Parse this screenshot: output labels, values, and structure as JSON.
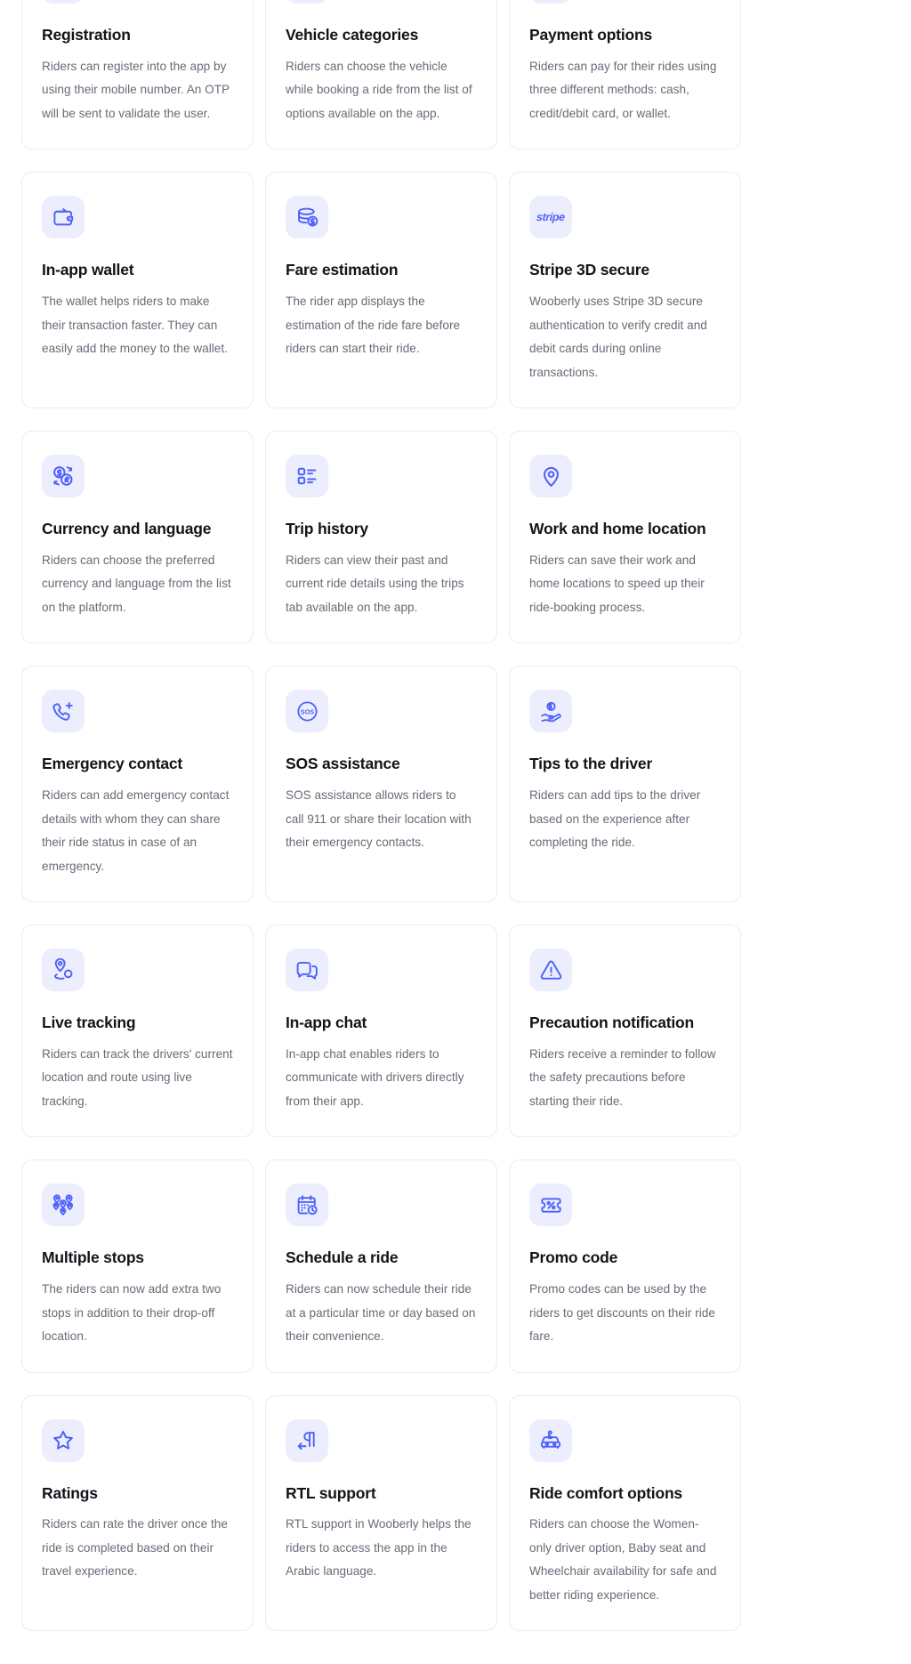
{
  "page": {
    "accent_color": "#4d61fc",
    "icon_bg_color": "#eceefd",
    "title_color": "#13131a",
    "text_color": "#6a6a78",
    "card_border_color": "#ececf1"
  },
  "features": [
    {
      "icon": "user-add-icon",
      "title": "Registration",
      "desc": "Riders can register into the app by using their mobile number. An OTP will be sent to validate the user."
    },
    {
      "icon": "car-front-icon",
      "title": "Vehicle categories",
      "desc": "Riders can choose the vehicle while booking a ride from the list of options available on the app."
    },
    {
      "icon": "credit-cards-icon",
      "title": "Payment options",
      "desc": "Riders can pay for their rides using three different methods: cash, credit/debit card, or wallet."
    },
    {
      "icon": "wallet-icon",
      "title": "In-app wallet",
      "desc": "The wallet helps riders to make their transaction faster. They can easily add the money to the wallet."
    },
    {
      "icon": "money-stack-icon",
      "title": "Fare estimation",
      "desc": "The rider app displays the estimation of the ride fare before riders can start their ride."
    },
    {
      "icon": "stripe-logo-icon",
      "title": "Stripe 3D secure",
      "desc": "Wooberly uses Stripe 3D secure authentication to verify credit and debit cards during online transactions."
    },
    {
      "icon": "currency-exchange-icon",
      "title": "Currency and language",
      "desc": "Riders can choose the preferred currency and language from the list on the platform."
    },
    {
      "icon": "list-details-icon",
      "title": "Trip history",
      "desc": "Riders can view their past and current ride details using the trips tab available on the app."
    },
    {
      "icon": "location-pin-icon",
      "title": "Work and home location",
      "desc": "Riders can save their work and home locations to speed up their ride-booking process."
    },
    {
      "icon": "phone-plus-icon",
      "title": "Emergency contact",
      "desc": "Riders can add emergency contact details with whom they can share their ride status in case of an emergency."
    },
    {
      "icon": "sos-icon",
      "title": "SOS assistance",
      "desc": "SOS assistance allows riders to call 911 or share their location with their emergency contacts."
    },
    {
      "icon": "tip-hand-coin-icon",
      "title": "Tips to the driver",
      "desc": "Riders can add tips to the driver based on the experience after completing the ride."
    },
    {
      "icon": "live-tracking-pin-icon",
      "title": "Live tracking",
      "desc": "Riders can track the drivers' current location and route using live tracking."
    },
    {
      "icon": "chat-bubbles-icon",
      "title": "In-app chat",
      "desc": "In-app chat enables riders to communicate with drivers directly from their app."
    },
    {
      "icon": "warning-triangle-icon",
      "title": "Precaution notification",
      "desc": "Riders receive a reminder to follow the safety precautions before starting their ride."
    },
    {
      "icon": "multiple-stops-pins-icon",
      "title": "Multiple stops",
      "desc": "The riders can now add extra two stops in addition to their drop-off location."
    },
    {
      "icon": "calendar-clock-icon",
      "title": "Schedule a ride",
      "desc": "Riders can now schedule their ride at a particular time or day based on their convenience."
    },
    {
      "icon": "promo-ticket-percent-icon",
      "title": "Promo code",
      "desc": "Promo codes can be used by the riders to get discounts on their ride fare."
    },
    {
      "icon": "star-outline-icon",
      "title": "Ratings",
      "desc": "Riders can rate the driver once the ride is completed based on their travel experience."
    },
    {
      "icon": "rtl-paragraph-icon",
      "title": "RTL support",
      "desc": "RTL support in Wooberly helps the riders to access the app in the Arabic language."
    },
    {
      "icon": "car-accessibility-icon",
      "title": "Ride comfort options",
      "desc": "Riders can choose the Women-only driver option, Baby seat and Wheelchair availability for safe and better riding experience."
    }
  ]
}
